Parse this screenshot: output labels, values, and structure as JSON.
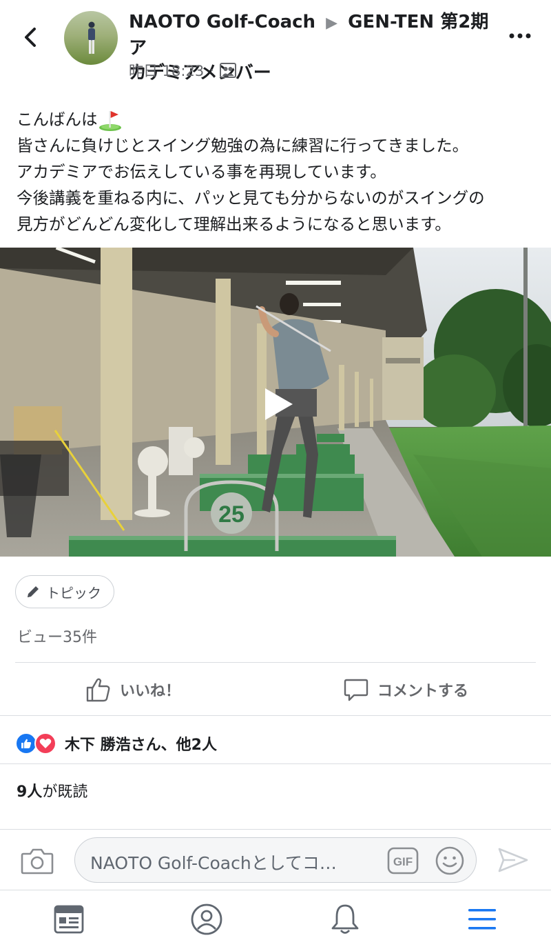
{
  "header": {
    "author": "NAOTO Golf-Coach",
    "separator": "▶",
    "group_line1": "GEN-TEN 第2期ア",
    "group_line2": "カデミアメンバー",
    "timestamp": "昨日 18:23",
    "dot": "·",
    "back_icon": "chevron-left-icon",
    "more_icon": "more-horizontal-icon",
    "privacy_icon": "group-audience-icon"
  },
  "post": {
    "lines": [
      "こんばんは",
      "皆さんに負けじとスイング勉強の為に練習に行ってきました。",
      "アカデミアでお伝えしている事を再現しています。",
      "今後講義を重ねる内に、パッと見ても分からないのがスイングの",
      "見方がどんどん変化して理解出来るようになると思います。"
    ],
    "emoji": "golf-flag-icon"
  },
  "video": {
    "bay_number": "25",
    "play_icon": "play-icon"
  },
  "topic": {
    "label": "トピック",
    "icon": "pencil-icon"
  },
  "views": "ビュー35件",
  "actions": {
    "like_label": "いいね！",
    "comment_label": "コメントする",
    "like_icon": "thumbs-up-icon",
    "comment_icon": "comment-icon"
  },
  "reactions": {
    "text": "木下 勝浩さん、他2人",
    "icons": [
      "like-reaction-icon",
      "love-reaction-icon"
    ]
  },
  "seen": {
    "count": "9人",
    "suffix": "が既読"
  },
  "comment_bar": {
    "placeholder": "NAOTO Golf-Coachとしてコ…",
    "gif_label": "GIF",
    "camera_icon": "camera-icon",
    "emoji_icon": "smiley-icon",
    "send_icon": "send-icon"
  },
  "nav": {
    "items": [
      "news-feed-icon",
      "profile-icon",
      "notifications-icon",
      "menu-icon"
    ]
  },
  "colors": {
    "accent": "#1877f2",
    "love": "#f33e58",
    "menu_active": "#1877f2",
    "muted_text": "#65676b"
  }
}
